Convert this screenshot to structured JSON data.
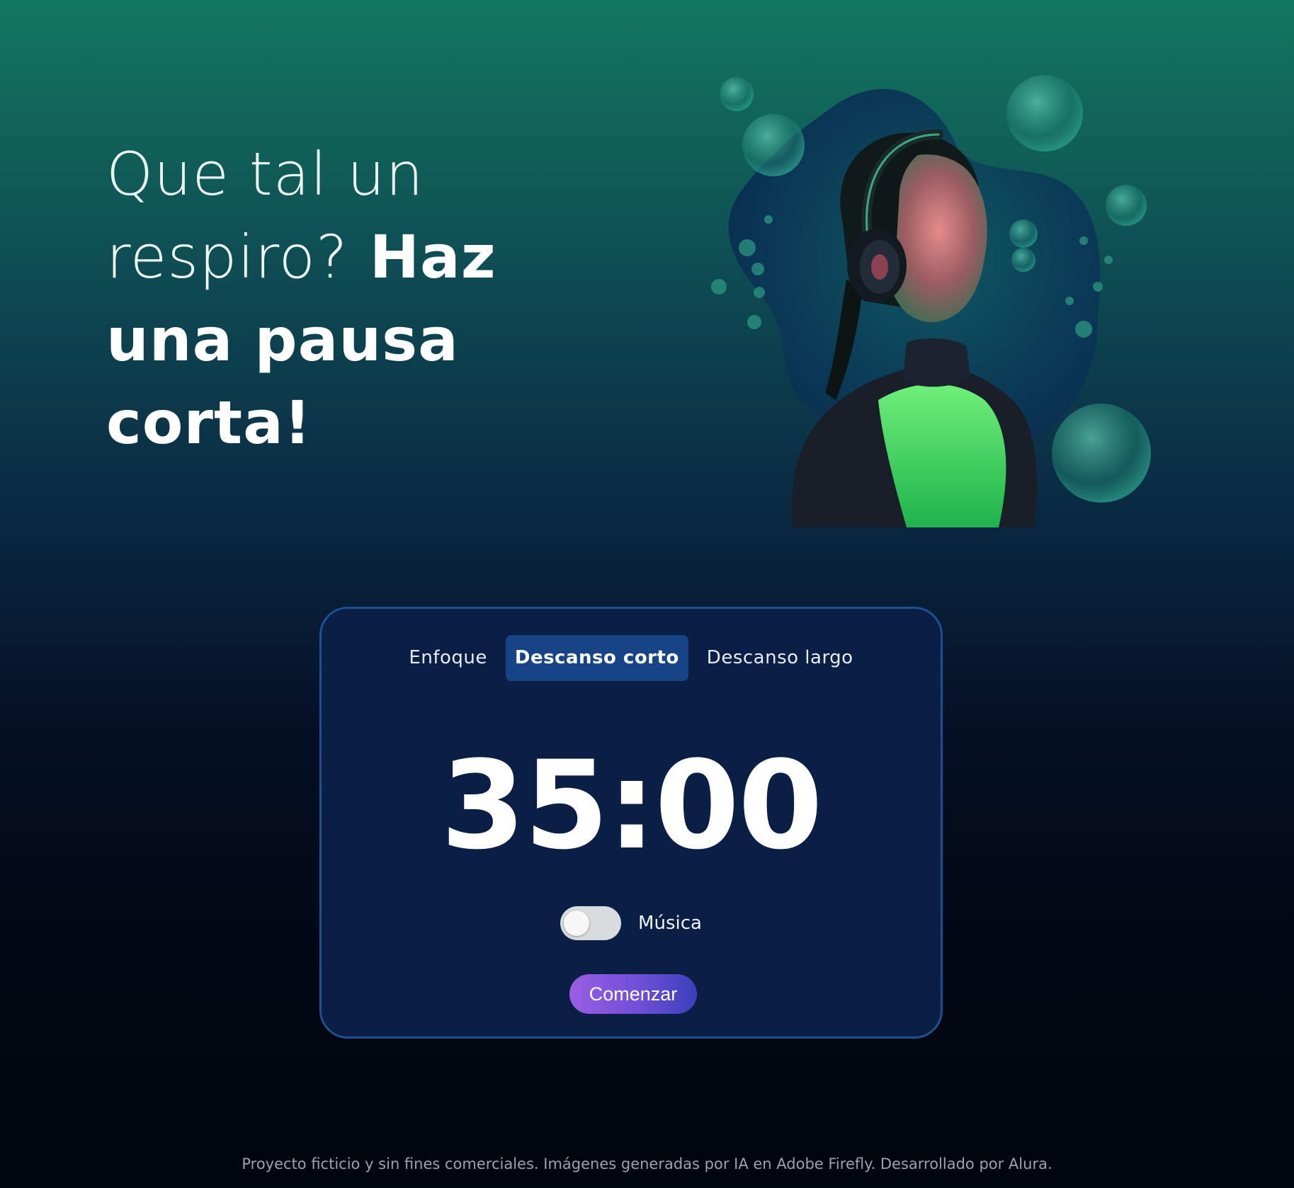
{
  "headline": {
    "line1": "Que tal un",
    "line2_light": "respiro?",
    "line2_bold": "Haz",
    "line3": "una pausa",
    "line4": "corta!"
  },
  "hero": {
    "description_icon": "woman-headphones-underwater-illustration"
  },
  "tabs": [
    {
      "label": "Enfoque",
      "active": false
    },
    {
      "label": "Descanso corto",
      "active": true
    },
    {
      "label": "Descanso largo",
      "active": false
    }
  ],
  "timer": {
    "display": "35:00"
  },
  "music": {
    "label": "Música",
    "enabled": false
  },
  "start_button": {
    "label": "Comenzar"
  },
  "footer": {
    "text": "Proyecto ficticio y sin fines comerciales. Imágenes generadas por IA en Adobe Firefly. Desarrollado por Alura."
  },
  "colors": {
    "card_bg": "#0a1e46",
    "card_border": "#1d4f93",
    "active_tab": "#174486",
    "button_gradient_start": "#9a5ee3",
    "button_gradient_end": "#3a3fb8",
    "bg_top": "#13775f",
    "bg_bottom": "#01050c"
  }
}
